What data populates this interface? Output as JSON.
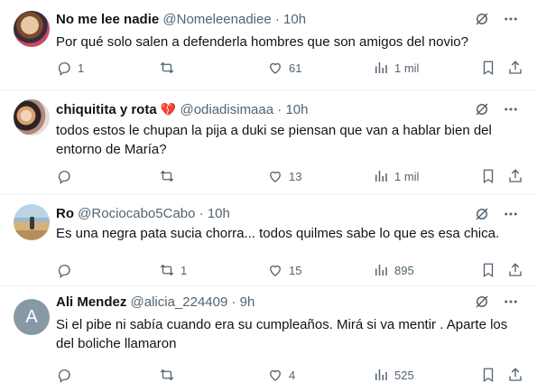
{
  "tweets": [
    {
      "name": "No me lee nadie",
      "handle": "@Nomeleenadiee",
      "dot": "·",
      "time": "10h",
      "text": "Por qué solo salen a defenderla hombres que son amigos del novio?",
      "replies": "1",
      "retweets": "",
      "likes": "61",
      "views": "1 mil"
    },
    {
      "name": "chiquitita y rota",
      "emoji": "💔",
      "handle": "@odiadisimaaa",
      "dot": "·",
      "time": "10h",
      "text": "todos estos le chupan la pija a duki se piensan que van a hablar bien del entorno de María?",
      "replies": "",
      "retweets": "",
      "likes": "13",
      "views": "1 mil"
    },
    {
      "name": "Ro",
      "handle": "@Rociocabo5Cabo",
      "dot": "·",
      "time": "10h",
      "text": "Es una negra pata sucia chorra... todos quilmes sabe lo que es esa chica.",
      "replies": "",
      "retweets": "1",
      "likes": "15",
      "views": "895"
    },
    {
      "name": "Ali Mendez",
      "handle": "@alicia_224409",
      "dot": "·",
      "time": "9h",
      "avatar_letter": "A",
      "text": "Si el pibe ni sabía cuando era su cumpleaños. Mirá si va mentir . Aparte los del boliche llamaron",
      "replies": "",
      "retweets": "",
      "likes": "4",
      "views": "525"
    }
  ],
  "icons": {
    "grok": "grok-icon",
    "more": "more-icon",
    "reply": "reply-icon",
    "retweet": "retweet-icon",
    "like": "like-icon",
    "views": "views-icon",
    "bookmark": "bookmark-icon",
    "share": "share-icon"
  },
  "colors": {
    "text": "#0f1419",
    "muted": "#536471",
    "divider": "#eff3f4",
    "broken_heart": "#e0245e",
    "default_avatar": "#8899a6"
  }
}
